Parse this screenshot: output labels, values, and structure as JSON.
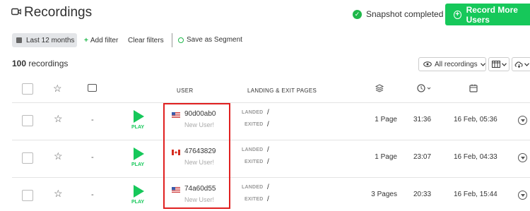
{
  "header": {
    "title": "Recordings",
    "snapshot_status": "Snapshot completed",
    "record_button": "Record More Users"
  },
  "filters": {
    "date_range": "Last 12 months",
    "add_filter": "Add filter",
    "clear_filters": "Clear filters",
    "save_segment": "Save as Segment"
  },
  "summary": {
    "count": "100",
    "count_label": "recordings",
    "view_select": "All recordings"
  },
  "table": {
    "headers": {
      "user": "USER",
      "landing_exit": "LANDING & EXIT PAGES"
    },
    "play_label": "PLAY",
    "landed_label": "LANDED",
    "exited_label": "EXITED",
    "rows": [
      {
        "user_id": "90d00ab0",
        "user_type": "New User!",
        "flag": "US",
        "landed": "/",
        "exited": "/",
        "pages": "1 Page",
        "duration": "31:36",
        "date": "16 Feb, 05:36",
        "dash": "-"
      },
      {
        "user_id": "47643829",
        "user_type": "New User!",
        "flag": "CA",
        "landed": "/",
        "exited": "/",
        "pages": "1 Page",
        "duration": "23:07",
        "date": "16 Feb, 04:33",
        "dash": "-"
      },
      {
        "user_id": "74a60d55",
        "user_type": "New User!",
        "flag": "US",
        "landed": "/",
        "exited": "/",
        "pages": "3 Pages",
        "duration": "20:33",
        "date": "16 Feb, 15:44",
        "dash": "-"
      }
    ]
  },
  "colors": {
    "accent_green": "#16c85a",
    "highlight_red": "#e02020"
  }
}
